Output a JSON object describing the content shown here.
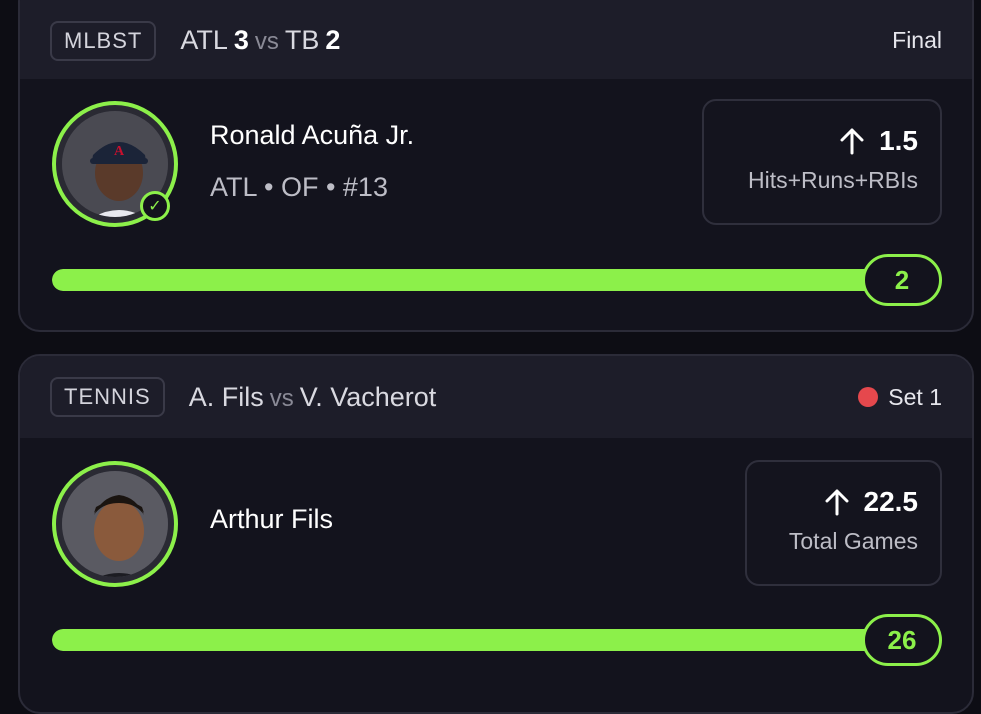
{
  "cards": [
    {
      "league": "MLBST",
      "team_a": "ATL",
      "score_a": "3",
      "vs": "vs",
      "team_b": "TB",
      "score_b": "2",
      "status": "Final",
      "player_name": "Ronald Acuña Jr.",
      "player_meta": "ATL • OF • #13",
      "line_value": "1.5",
      "line_stat": "Hits+Runs+RBIs",
      "direction_icon": "arrow-up-icon",
      "verified_icon": "check-circle-icon",
      "progress_count": "2",
      "progress_fraction": 1.0
    },
    {
      "league": "TENNIS",
      "team_a": "A. Fils",
      "vs": "vs",
      "team_b": "V. Vacherot",
      "status": "Set 1",
      "status_dot_color": "#e5484d",
      "player_name": "Arthur Fils",
      "line_value": "22.5",
      "line_stat": "Total Games",
      "direction_icon": "arrow-up-icon",
      "progress_count": "26",
      "progress_fraction": 1.0
    }
  ],
  "colors": {
    "accent": "#8cf04a",
    "background": "#0d0d14",
    "card": "#13131d",
    "header": "#1d1d29",
    "live": "#e5484d"
  }
}
